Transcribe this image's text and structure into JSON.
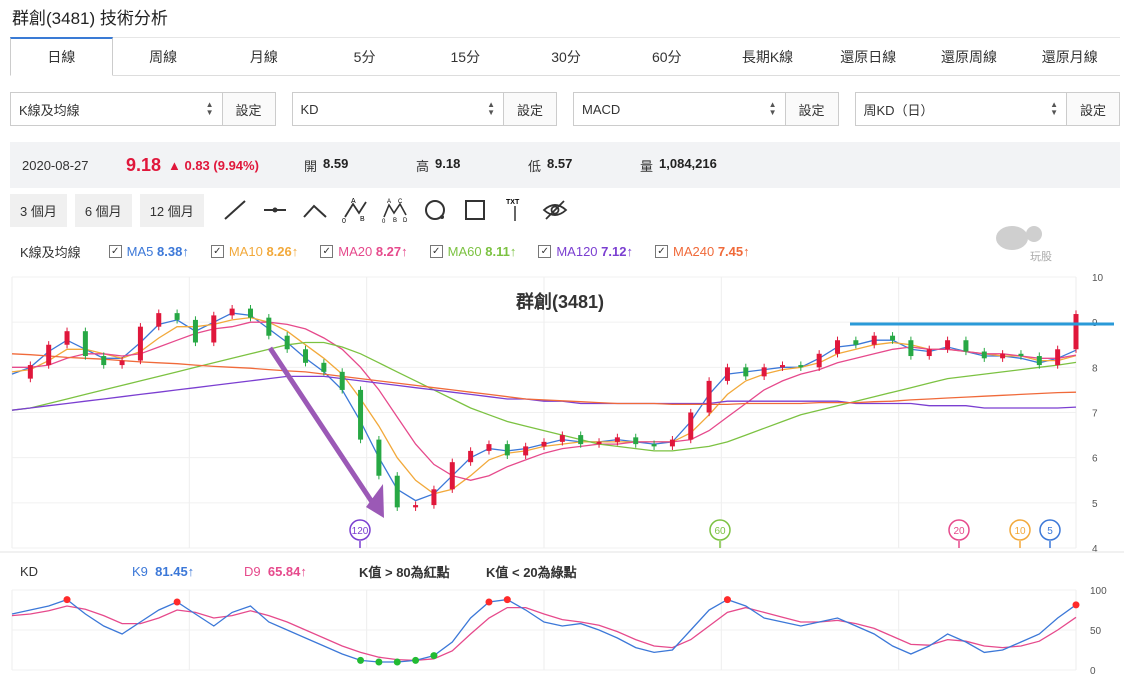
{
  "page_title": "群創(3481) 技術分析",
  "tabs": [
    "日線",
    "周線",
    "月線",
    "5分",
    "15分",
    "30分",
    "60分",
    "長期K線",
    "還原日線",
    "還原周線",
    "還原月線"
  ],
  "selectors": [
    {
      "value": "K線及均線",
      "button": "設定"
    },
    {
      "value": "KD",
      "button": "設定"
    },
    {
      "value": "MACD",
      "button": "設定"
    },
    {
      "value": "周KD（日）",
      "button": "設定"
    }
  ],
  "quote": {
    "date": "2020-08-27",
    "price": "9.18",
    "change": "0.83 (9.94%)",
    "open_label": "開",
    "open": "8.59",
    "high_label": "高",
    "high": "9.18",
    "low_label": "低",
    "low": "8.57",
    "volume_label": "量",
    "volume": "1,084,216"
  },
  "periods": [
    "3 個月",
    "6 個月",
    "12 個月"
  ],
  "drawing_tools": [
    "line-tool-icon",
    "horizontal-line-tool-icon",
    "angle-tool-icon",
    "abc-pattern-tool-icon",
    "abcd-pattern-tool-icon",
    "circle-tool-icon",
    "rectangle-tool-icon",
    "text-tool-icon",
    "hide-drawings-icon"
  ],
  "tool_text": {
    "a": "A",
    "b": "B",
    "zero": "0",
    "c": "C",
    "d": "D",
    "txt": "TXT"
  },
  "logo_text": "玩股網",
  "ma_legend": {
    "label": "K線及均線",
    "items": [
      {
        "name": "MA5",
        "value": "8.38↑",
        "color": "#3c78d8"
      },
      {
        "name": "MA10",
        "value": "8.26↑",
        "color": "#f2a93b"
      },
      {
        "name": "MA20",
        "value": "8.27↑",
        "color": "#e64a8c"
      },
      {
        "name": "MA60",
        "value": "8.11↑",
        "color": "#7cc242"
      },
      {
        "name": "MA120",
        "value": "7.12↑",
        "color": "#7b3fd1"
      },
      {
        "name": "MA240",
        "value": "7.45↑",
        "color": "#f06a3a"
      }
    ]
  },
  "kd_legend": {
    "label": "KD",
    "k_name": "K9",
    "k_value": "81.45↑",
    "d_name": "D9",
    "d_value": "65.84↑",
    "note1": "K值 > 80為紅點",
    "note2": "K值 < 20為綠點"
  },
  "colors": {
    "up": "#e0173b",
    "down": "#27a844",
    "resistance": "#2a9ad8",
    "arrow": "#9b59b6"
  },
  "chart_data": {
    "type": "line",
    "title": "群創(3481)",
    "price_axis": {
      "ylim": [
        4,
        10
      ],
      "ticks": [
        "4",
        "5",
        "6",
        "7",
        "8",
        "9",
        "10"
      ]
    },
    "kd_axis": {
      "ylim": [
        0,
        100
      ],
      "ticks": [
        "0",
        "50",
        "100"
      ]
    },
    "ma_markers": [
      "120",
      "60",
      "20",
      "10",
      "5"
    ],
    "x": [
      0,
      5,
      10,
      15,
      20,
      25,
      30,
      35,
      40,
      45,
      50,
      55,
      60,
      65,
      70,
      75,
      80,
      85,
      90,
      95,
      100,
      105,
      110,
      115,
      120,
      125,
      130,
      135,
      140,
      145,
      150,
      155,
      160,
      165,
      170,
      175,
      180,
      185,
      190,
      195,
      200,
      205,
      210,
      215,
      220,
      225,
      230,
      235,
      240,
      245,
      250,
      255,
      260,
      265,
      270,
      275,
      280,
      285,
      290
    ],
    "close": [
      7.75,
      8.05,
      8.5,
      8.8,
      8.25,
      8.05,
      8.15,
      8.9,
      9.2,
      9.05,
      8.55,
      9.15,
      9.3,
      9.1,
      8.7,
      8.4,
      8.1,
      7.9,
      7.5,
      6.4,
      5.6,
      4.9,
      4.95,
      5.3,
      5.9,
      6.15,
      6.3,
      6.05,
      6.25,
      6.35,
      6.5,
      6.3,
      6.35,
      6.45,
      6.3,
      6.25,
      6.4,
      7.0,
      7.7,
      8.0,
      7.8,
      8.0,
      8.05,
      8.0,
      8.3,
      8.6,
      8.5,
      8.7,
      8.6,
      8.25,
      8.4,
      8.6,
      8.35,
      8.2,
      8.3,
      8.25,
      8.05,
      8.4,
      9.18
    ],
    "series": [
      {
        "name": "MA5",
        "values": [
          7.85,
          8.0,
          8.35,
          8.6,
          8.4,
          8.2,
          8.2,
          8.55,
          8.95,
          9.05,
          8.8,
          9.0,
          9.2,
          9.15,
          8.85,
          8.55,
          8.2,
          7.9,
          7.5,
          6.8,
          6.0,
          5.3,
          5.05,
          5.2,
          5.6,
          6.0,
          6.2,
          6.15,
          6.2,
          6.3,
          6.4,
          6.35,
          6.35,
          6.4,
          6.35,
          6.3,
          6.35,
          6.8,
          7.4,
          7.85,
          7.9,
          7.95,
          8.0,
          8.0,
          8.2,
          8.45,
          8.5,
          8.6,
          8.6,
          8.4,
          8.35,
          8.45,
          8.35,
          8.25,
          8.25,
          8.2,
          8.1,
          8.2,
          8.38
        ]
      },
      {
        "name": "MA10",
        "values": [
          7.9,
          7.95,
          8.15,
          8.4,
          8.4,
          8.3,
          8.2,
          8.35,
          8.65,
          8.9,
          8.9,
          8.95,
          9.05,
          9.1,
          9.0,
          8.8,
          8.5,
          8.2,
          7.85,
          7.3,
          6.7,
          6.0,
          5.5,
          5.2,
          5.3,
          5.6,
          5.95,
          6.1,
          6.15,
          6.25,
          6.3,
          6.35,
          6.35,
          6.35,
          6.35,
          6.35,
          6.35,
          6.55,
          6.95,
          7.4,
          7.7,
          7.85,
          7.95,
          8.0,
          8.1,
          8.3,
          8.4,
          8.5,
          8.55,
          8.5,
          8.4,
          8.4,
          8.35,
          8.3,
          8.25,
          8.25,
          8.15,
          8.15,
          8.26
        ]
      },
      {
        "name": "MA20",
        "values": [
          8.0,
          8.0,
          8.05,
          8.2,
          8.3,
          8.3,
          8.25,
          8.3,
          8.45,
          8.6,
          8.75,
          8.85,
          8.9,
          9.0,
          9.0,
          8.95,
          8.85,
          8.65,
          8.4,
          8.0,
          7.5,
          6.9,
          6.3,
          5.85,
          5.6,
          5.5,
          5.6,
          5.8,
          5.95,
          6.1,
          6.2,
          6.25,
          6.3,
          6.3,
          6.35,
          6.35,
          6.35,
          6.4,
          6.6,
          6.9,
          7.2,
          7.5,
          7.7,
          7.85,
          7.95,
          8.1,
          8.2,
          8.3,
          8.4,
          8.45,
          8.4,
          8.4,
          8.35,
          8.3,
          8.3,
          8.25,
          8.2,
          8.2,
          8.27
        ]
      },
      {
        "name": "MA60",
        "values": [
          7.05,
          7.1,
          7.2,
          7.3,
          7.4,
          7.5,
          7.6,
          7.7,
          7.8,
          7.9,
          8.0,
          8.1,
          8.2,
          8.3,
          8.4,
          8.5,
          8.55,
          8.55,
          8.45,
          8.3,
          8.1,
          7.9,
          7.7,
          7.5,
          7.3,
          7.1,
          6.95,
          6.8,
          6.7,
          6.6,
          6.5,
          6.4,
          6.3,
          6.25,
          6.2,
          6.15,
          6.15,
          6.2,
          6.25,
          6.35,
          6.5,
          6.65,
          6.8,
          6.95,
          7.05,
          7.15,
          7.25,
          7.35,
          7.45,
          7.55,
          7.65,
          7.75,
          7.8,
          7.85,
          7.9,
          7.95,
          8.0,
          8.05,
          8.11
        ]
      },
      {
        "name": "MA120",
        "values": [
          7.05,
          7.1,
          7.15,
          7.2,
          7.25,
          7.3,
          7.35,
          7.4,
          7.45,
          7.5,
          7.55,
          7.6,
          7.65,
          7.7,
          7.75,
          7.8,
          7.8,
          7.8,
          7.75,
          7.7,
          7.65,
          7.6,
          7.55,
          7.5,
          7.45,
          7.4,
          7.35,
          7.3,
          7.3,
          7.25,
          7.25,
          7.2,
          7.2,
          7.2,
          7.2,
          7.2,
          7.2,
          7.2,
          7.2,
          7.25,
          7.25,
          7.25,
          7.25,
          7.25,
          7.25,
          7.25,
          7.2,
          7.2,
          7.2,
          7.2,
          7.15,
          7.15,
          7.15,
          7.1,
          7.1,
          7.1,
          7.1,
          7.1,
          7.12
        ]
      },
      {
        "name": "MA240",
        "values": [
          8.3,
          8.28,
          8.25,
          8.22,
          8.2,
          8.18,
          8.15,
          8.12,
          8.1,
          8.08,
          8.05,
          8.02,
          8.0,
          7.98,
          7.95,
          7.92,
          7.9,
          7.85,
          7.8,
          7.75,
          7.7,
          7.65,
          7.6,
          7.55,
          7.5,
          7.45,
          7.4,
          7.35,
          7.3,
          7.28,
          7.26,
          7.24,
          7.22,
          7.2,
          7.2,
          7.2,
          7.18,
          7.18,
          7.18,
          7.18,
          7.2,
          7.2,
          7.2,
          7.2,
          7.22,
          7.22,
          7.22,
          7.24,
          7.25,
          7.28,
          7.3,
          7.32,
          7.34,
          7.36,
          7.38,
          7.4,
          7.42,
          7.44,
          7.45
        ]
      },
      {
        "name": "K9",
        "values": [
          70,
          75,
          80,
          88,
          70,
          55,
          45,
          60,
          75,
          85,
          70,
          55,
          72,
          80,
          60,
          50,
          40,
          30,
          20,
          12,
          10,
          10,
          12,
          18,
          35,
          65,
          85,
          88,
          75,
          60,
          55,
          58,
          50,
          40,
          28,
          22,
          25,
          50,
          75,
          88,
          80,
          65,
          60,
          55,
          60,
          65,
          55,
          45,
          30,
          20,
          30,
          45,
          35,
          22,
          25,
          35,
          45,
          65,
          81.45
        ]
      },
      {
        "name": "D9",
        "values": [
          68,
          70,
          74,
          80,
          76,
          68,
          58,
          58,
          65,
          75,
          72,
          65,
          68,
          74,
          68,
          60,
          50,
          40,
          30,
          22,
          16,
          13,
          12,
          14,
          24,
          45,
          65,
          78,
          78,
          70,
          63,
          60,
          56,
          48,
          38,
          30,
          28,
          38,
          55,
          72,
          78,
          72,
          66,
          60,
          60,
          62,
          58,
          52,
          42,
          32,
          31,
          38,
          36,
          30,
          28,
          30,
          36,
          50,
          65.84
        ]
      }
    ]
  }
}
